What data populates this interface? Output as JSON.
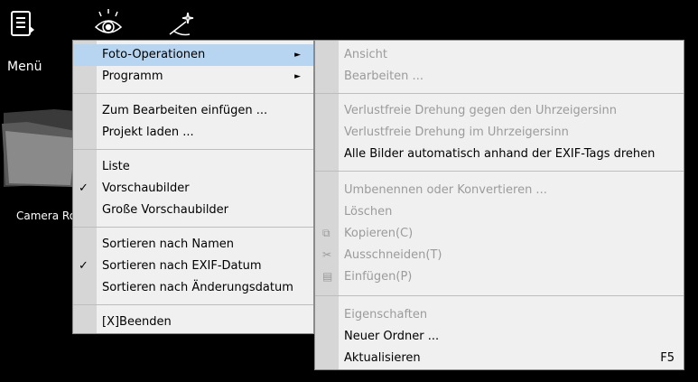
{
  "toolbar": {
    "menu_label": "Menü",
    "icons": [
      "document-menu-icon",
      "eye-icon",
      "magic-wand-icon"
    ]
  },
  "desktop": {
    "folder_label": "Camera Roll"
  },
  "main_menu": {
    "items": [
      {
        "label": "Foto-Operationen",
        "has_submenu": true,
        "highlighted": true
      },
      {
        "label": "Programm",
        "has_submenu": true
      },
      {
        "label": "Zum Bearbeiten einfügen ..."
      },
      {
        "label": "Projekt laden ..."
      },
      {
        "label": "Liste"
      },
      {
        "label": "Vorschaubilder",
        "checked": true
      },
      {
        "label": "Große Vorschaubilder"
      },
      {
        "label": "Sortieren nach Namen"
      },
      {
        "label": "Sortieren nach EXIF-Datum",
        "checked": true
      },
      {
        "label": "Sortieren nach Änderungsdatum"
      },
      {
        "label": "[X]Beenden"
      }
    ]
  },
  "sub_menu": {
    "items": [
      {
        "label": "Ansicht",
        "disabled": true
      },
      {
        "label": "Bearbeiten ...",
        "disabled": true
      },
      {
        "label": "Verlustfreie Drehung gegen den Uhrzeigersinn",
        "disabled": true
      },
      {
        "label": "Verlustfreie Drehung im Uhrzeigersinn",
        "disabled": true
      },
      {
        "label": "Alle Bilder automatisch anhand der EXIF-Tags drehen"
      },
      {
        "label": "Umbenennen oder Konvertieren ...",
        "disabled": true
      },
      {
        "label": "Löschen",
        "disabled": true
      },
      {
        "label": "Kopieren(C)",
        "disabled": true,
        "icon": "copy-icon"
      },
      {
        "label": "Ausschneiden(T)",
        "disabled": true,
        "icon": "scissors-icon"
      },
      {
        "label": "Einfügen(P)",
        "disabled": true,
        "icon": "paste-icon"
      },
      {
        "label": "Eigenschaften",
        "disabled": true
      },
      {
        "label": "Neuer Ordner ..."
      },
      {
        "label": "Aktualisieren",
        "shortcut": "F5"
      }
    ]
  },
  "colors": {
    "background": "#000000",
    "menu_bg": "#f0f0f0",
    "gutter": "#d6d6d6",
    "highlight": "#b7d5f1",
    "disabled_text": "#9b9b9b"
  }
}
